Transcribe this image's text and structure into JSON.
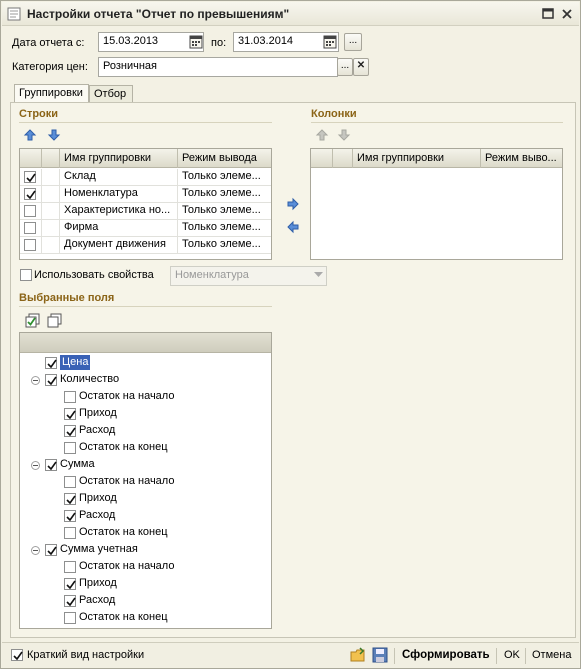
{
  "window": {
    "title": "Настройки отчета  \"Отчет по превышениям\""
  },
  "header": {
    "date_label": "Дата отчета с:",
    "date_from": "15.03.2013",
    "to_label": "по:",
    "date_to": "31.03.2014",
    "ellipsis": "...",
    "price_category_label": "Категория цен:",
    "price_category_value": "Розничная",
    "clear_symbol": "✕"
  },
  "tabs": [
    {
      "label": "Группировки",
      "active": true
    },
    {
      "label": "Отбор",
      "active": false
    }
  ],
  "rows_section": {
    "title": "Строки",
    "columns": [
      "Имя группировки",
      "Режим вывода"
    ],
    "rows": [
      {
        "checked": true,
        "name": "Склад",
        "mode": "Только элеме..."
      },
      {
        "checked": true,
        "name": "Номенклатура",
        "mode": "Только элеме..."
      },
      {
        "checked": false,
        "name": "Характеристика но...",
        "mode": "Только элеме..."
      },
      {
        "checked": false,
        "name": "Фирма",
        "mode": "Только элеме..."
      },
      {
        "checked": false,
        "name": "Документ движения",
        "mode": "Только элеме..."
      }
    ]
  },
  "columns_section": {
    "title": "Колонки",
    "columns": [
      "Имя группировки",
      "Режим выво..."
    ]
  },
  "use_properties": {
    "label": "Использовать свойства",
    "checked": false,
    "value": "Номенклатура"
  },
  "selected_fields": {
    "title": "Выбранные поля",
    "tree": [
      {
        "label": "Цена",
        "level": 0,
        "checked": true,
        "selected": true,
        "expandable": false
      },
      {
        "label": "Количество",
        "level": 0,
        "checked": true,
        "expandable": true
      },
      {
        "label": "Остаток на начало",
        "level": 1,
        "checked": false
      },
      {
        "label": "Приход",
        "level": 1,
        "checked": true
      },
      {
        "label": "Расход",
        "level": 1,
        "checked": true
      },
      {
        "label": "Остаток на конец",
        "level": 1,
        "checked": false
      },
      {
        "label": "Сумма",
        "level": 0,
        "checked": true,
        "expandable": true
      },
      {
        "label": "Остаток на начало",
        "level": 1,
        "checked": false
      },
      {
        "label": "Приход",
        "level": 1,
        "checked": true
      },
      {
        "label": "Расход",
        "level": 1,
        "checked": true
      },
      {
        "label": "Остаток на конец",
        "level": 1,
        "checked": false
      },
      {
        "label": "Сумма учетная",
        "level": 0,
        "checked": true,
        "expandable": true
      },
      {
        "label": "Остаток на начало",
        "level": 1,
        "checked": false
      },
      {
        "label": "Приход",
        "level": 1,
        "checked": true
      },
      {
        "label": "Расход",
        "level": 1,
        "checked": true
      },
      {
        "label": "Остаток на конец",
        "level": 1,
        "checked": false
      }
    ]
  },
  "footer": {
    "short_view_label": "Краткий вид настройки",
    "short_view_checked": true,
    "generate_label": "Сформировать",
    "ok_label": "OK",
    "cancel_label": "Отмена"
  }
}
